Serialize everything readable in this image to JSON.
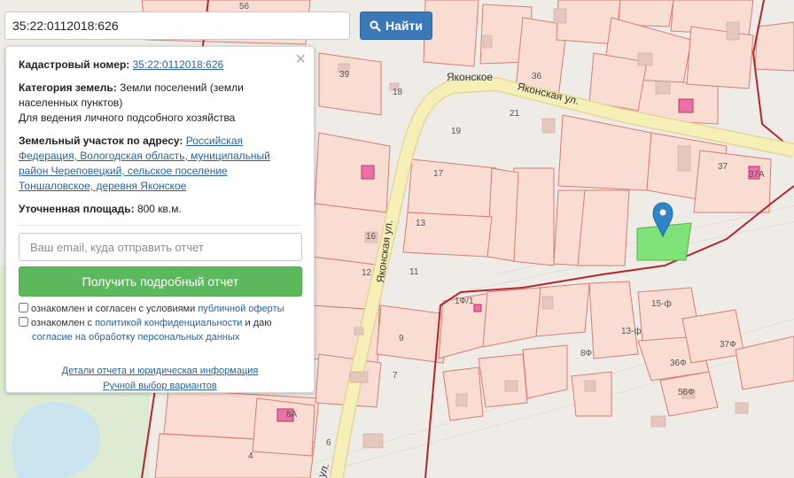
{
  "search": {
    "value": "35:22:0112018:626",
    "button_label": "Найти"
  },
  "panel": {
    "cadastral_label": "Кадастровый номер:",
    "cadastral_value": "35:22:0112018:626",
    "category_label": "Категория земель:",
    "category_value": "Земли поселений (земли населенных пунктов)",
    "usage": "Для ведения личного подсобного хозяйства",
    "address_label": "Земельный участок по адресу:",
    "address_value": "Российская Федерация, Вологодская область, муниципальный район Череповецкий, сельское поселение Тоншаловское, деревня Яконское",
    "area_label": "Уточненная площадь:",
    "area_value": "800 кв.м.",
    "email_placeholder": "Ваш email, куда отправить отчет",
    "report_button": "Получить подробный отчет",
    "consent1_text": "ознакомлен и согласен с условиями",
    "consent1_link": "публичной оферты",
    "consent2_text": "ознакомлен с",
    "consent2_link": "политикой конфиденциальности",
    "consent2_tail": "и даю",
    "consent2_link2": "согласие на обработку персональных данных",
    "details_link": "Детали отчета и юридическая информация",
    "manual_link": "Ручной выбор вариантов",
    "close_symbol": "×"
  },
  "map": {
    "village_label": "Яконское",
    "street_main": "Яконская ул.",
    "street_side": "Яконская ул.",
    "street_bottom": "ул.",
    "parcel_numbers": [
      "56",
      "39",
      "18",
      "36",
      "21",
      "19",
      "17",
      "13",
      "11",
      "16",
      "12",
      "9",
      "7",
      "8А",
      "6",
      "4",
      "37",
      "37А",
      "15-ф",
      "13-ф",
      "8Ф",
      "36Ф",
      "37Ф",
      "56Ф",
      "1Ф/1"
    ],
    "colors": {
      "parcel_fill": "#f9ddd3",
      "parcel_stroke": "#d97c71",
      "boundary": "#b3262e",
      "road": "#f7efb8",
      "selected": "#7fe37a",
      "marker": "#2e86c9"
    }
  }
}
